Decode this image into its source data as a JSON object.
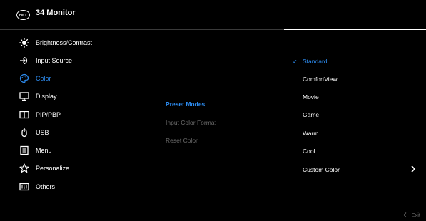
{
  "header": {
    "logo_text": "DELL",
    "title": "34 Monitor"
  },
  "menu": {
    "items": [
      {
        "label": "Brightness/Contrast",
        "icon": "brightness-icon"
      },
      {
        "label": "Input Source",
        "icon": "input-source-icon"
      },
      {
        "label": "Color",
        "icon": "color-palette-icon",
        "active": true
      },
      {
        "label": "Display",
        "icon": "display-icon"
      },
      {
        "label": "PIP/PBP",
        "icon": "pip-icon"
      },
      {
        "label": "USB",
        "icon": "usb-icon"
      },
      {
        "label": "Menu",
        "icon": "menu-icon"
      },
      {
        "label": "Personalize",
        "icon": "star-icon"
      },
      {
        "label": "Others",
        "icon": "others-icon"
      }
    ]
  },
  "submenu": {
    "items": [
      {
        "label": "Preset Modes",
        "active": true
      },
      {
        "label": "Input Color Format"
      },
      {
        "label": "Reset Color"
      }
    ]
  },
  "options": {
    "items": [
      {
        "label": "Standard",
        "selected": true
      },
      {
        "label": "ComfortView"
      },
      {
        "label": "Movie"
      },
      {
        "label": "Game"
      },
      {
        "label": "Warm"
      },
      {
        "label": "Cool"
      },
      {
        "label": "Custom Color",
        "has_submenu": true
      }
    ]
  },
  "footer": {
    "exit_label": "Exit"
  },
  "colors": {
    "accent": "#2d8cf0",
    "background": "#000000",
    "dim_text": "#6c6c6c"
  }
}
